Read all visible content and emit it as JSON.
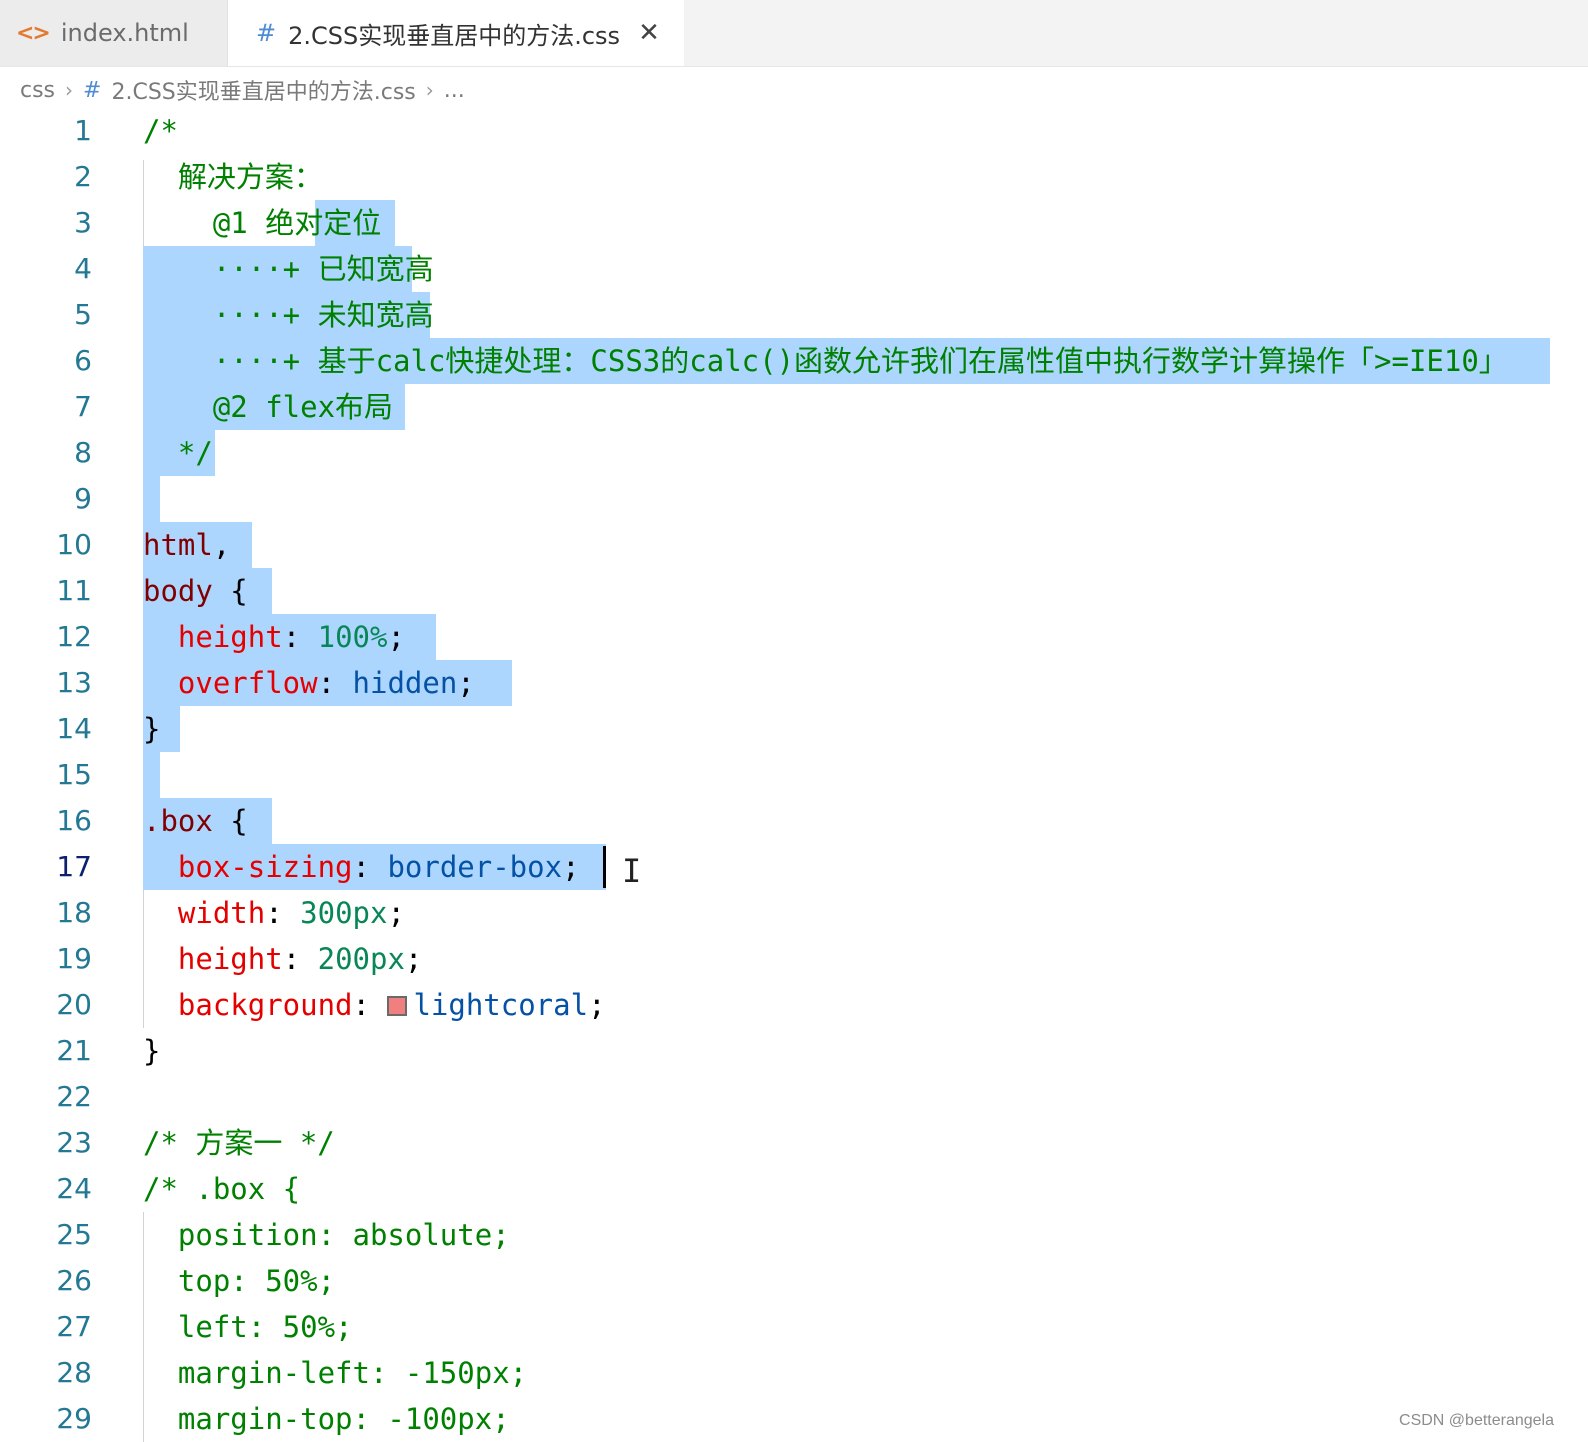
{
  "tabs": [
    {
      "icon": "html-file-icon",
      "label": "index.html",
      "active": false
    },
    {
      "icon": "css-file-icon",
      "label": "2.CSS实现垂直居中的方法.css",
      "active": true
    }
  ],
  "breadcrumb": {
    "folder": "css",
    "file": "2.CSS实现垂直居中的方法.css",
    "more": "..."
  },
  "editor": {
    "active_line": 17,
    "line_numbers": [
      "1",
      "2",
      "3",
      "4",
      "5",
      "6",
      "7",
      "8",
      "9",
      "10",
      "11",
      "12",
      "13",
      "14",
      "15",
      "16",
      "17",
      "18",
      "19",
      "20",
      "21",
      "22",
      "23",
      "24",
      "25",
      "26",
      "27",
      "28",
      "29"
    ],
    "lines": [
      [
        [
          "/*",
          "comment"
        ]
      ],
      [
        [
          "  解决方案：",
          "comment"
        ]
      ],
      [
        [
          "    @1 绝对定位",
          "comment"
        ]
      ],
      [
        [
          "    ····+ 已知宽高",
          "comment"
        ]
      ],
      [
        [
          "    ····+ 未知宽高",
          "comment"
        ]
      ],
      [
        [
          "    ····+ 基于calc快捷处理：CSS3的calc()函数允许我们在属性值中执行数学计算操作「>=IE10」",
          "comment"
        ]
      ],
      [
        [
          "    @2 flex布局",
          "comment"
        ]
      ],
      [
        [
          "  */",
          "comment"
        ]
      ],
      [],
      [
        [
          "html",
          "sel"
        ],
        [
          ",",
          "punct"
        ]
      ],
      [
        [
          "body",
          "sel"
        ],
        [
          " {",
          "punct"
        ]
      ],
      [
        [
          "  ",
          "punct"
        ],
        [
          "height",
          "prop"
        ],
        [
          ": ",
          "punct"
        ],
        [
          "100%",
          "num"
        ],
        [
          ";",
          "punct"
        ]
      ],
      [
        [
          "  ",
          "punct"
        ],
        [
          "overflow",
          "prop"
        ],
        [
          ": ",
          "punct"
        ],
        [
          "hidden",
          "val"
        ],
        [
          ";",
          "punct"
        ]
      ],
      [
        [
          "}",
          "punct"
        ]
      ],
      [],
      [
        [
          ".box",
          "sel"
        ],
        [
          " {",
          "punct"
        ]
      ],
      [
        [
          "  ",
          "punct"
        ],
        [
          "box-sizing",
          "prop"
        ],
        [
          ": ",
          "punct"
        ],
        [
          "border-box",
          "val"
        ],
        [
          ";",
          "punct"
        ]
      ],
      [
        [
          "  ",
          "punct"
        ],
        [
          "width",
          "prop"
        ],
        [
          ": ",
          "punct"
        ],
        [
          "300px",
          "num"
        ],
        [
          ";",
          "punct"
        ]
      ],
      [
        [
          "  ",
          "punct"
        ],
        [
          "height",
          "prop"
        ],
        [
          ": ",
          "punct"
        ],
        [
          "200px",
          "num"
        ],
        [
          ";",
          "punct"
        ]
      ],
      [
        [
          "  ",
          "punct"
        ],
        [
          "background",
          "prop"
        ],
        [
          ": ",
          "punct"
        ],
        [
          "",
          "swatch"
        ],
        [
          "lightcoral",
          "val"
        ],
        [
          ";",
          "punct"
        ]
      ],
      [
        [
          "}",
          "punct"
        ]
      ],
      [],
      [
        [
          "/* 方案一 */",
          "comment"
        ]
      ],
      [
        [
          "/* .box {",
          "comment"
        ]
      ],
      [
        [
          "  position: absolute;",
          "comment"
        ]
      ],
      [
        [
          "  top: 50%;",
          "comment"
        ]
      ],
      [
        [
          "  left: 50%;",
          "comment"
        ]
      ],
      [
        [
          "  margin-left: -150px;",
          "comment"
        ]
      ],
      [
        [
          "  margin-top: -100px;",
          "comment"
        ]
      ]
    ]
  },
  "colors": {
    "selection": "#add6ff",
    "comment": "#008000",
    "selector": "#800000",
    "property": "#e50000",
    "number": "#098658",
    "value": "#0451a5",
    "swatch": "#f08080"
  },
  "watermark": "CSDN @betterangela"
}
